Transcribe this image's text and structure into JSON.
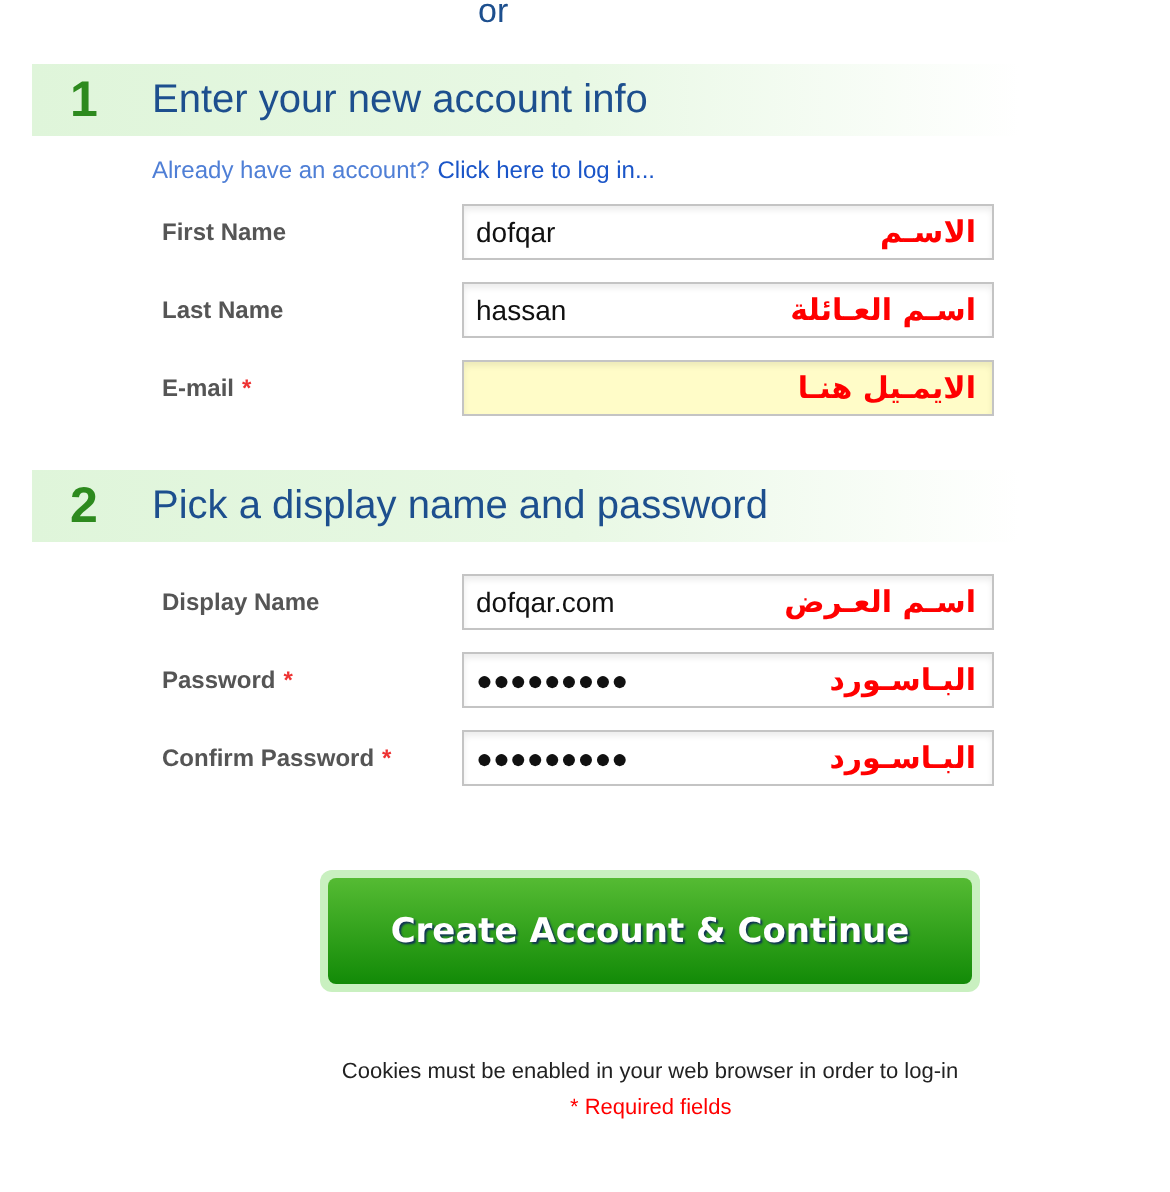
{
  "top_text": "or",
  "sections": [
    {
      "number": "1",
      "title": "Enter your new account info",
      "login_prompt": {
        "text": "Already have an account?",
        "link": "Click here to log in..."
      },
      "fields": [
        {
          "label": "First Name",
          "value": "dofqar",
          "annotation": "الاسـم",
          "highlighted": false
        },
        {
          "label": "Last Name",
          "value": "hassan",
          "annotation": "اسـم العـائلة",
          "highlighted": false
        },
        {
          "label": "E-mail",
          "required_mark": "*",
          "annotation": "الايمـيل هنـا",
          "highlighted": true
        }
      ]
    },
    {
      "number": "2",
      "title": "Pick a display name and password",
      "fields": [
        {
          "label": "Display Name",
          "value": "dofqar.com",
          "annotation": "اسـم العـرض",
          "highlighted": false
        },
        {
          "label": "Password",
          "required_mark": "*",
          "value": "●●●●●●●●●",
          "annotation": "البـاسـورد",
          "highlighted": false
        },
        {
          "label": "Confirm Password",
          "required_mark": "*",
          "value": "●●●●●●●●●",
          "annotation": "البـاسـورد",
          "highlighted": false
        }
      ]
    }
  ],
  "submit_button": "Create Account & Continue",
  "cookies_note": "Cookies must be enabled in your web browser in order to log-in",
  "required_note": "* Required fields"
}
